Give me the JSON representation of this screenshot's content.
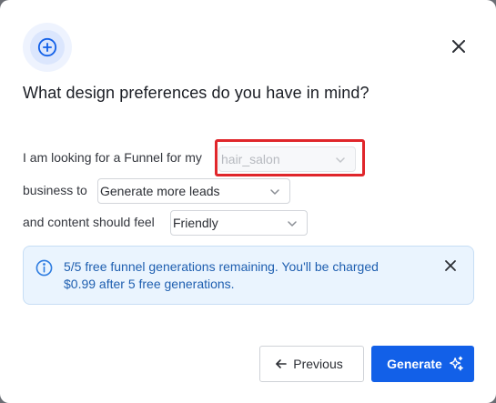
{
  "modal": {
    "title": "What design preferences do you have in mind?"
  },
  "form": {
    "row1_label": "I am looking for a Funnel for my",
    "row1_select_value": "hair_salon",
    "row2_label": "business to",
    "row2_select_value": "Generate more leads",
    "row3_label": "and content should feel",
    "row3_select_value": "Friendly"
  },
  "info": {
    "text": "5/5 free funnel generations remaining. You'll be charged $0.99 after 5 free generations."
  },
  "buttons": {
    "previous": "Previous",
    "generate": "Generate"
  },
  "icons": {
    "header": "plus-circle-icon",
    "close": "close-icon",
    "info": "info-icon",
    "chevron": "chevron-down-icon",
    "back": "arrow-left-icon",
    "sparkle": "sparkle-icon"
  },
  "colors": {
    "accent": "#1260e8",
    "highlight": "#e0262b",
    "info_bg": "#eaf4fe",
    "info_text": "#1f5fb0"
  }
}
